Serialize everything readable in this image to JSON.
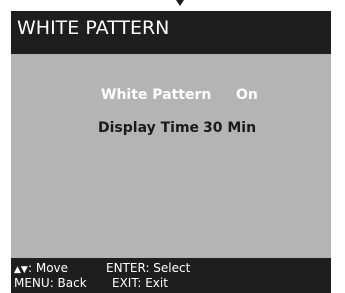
{
  "osd": {
    "title": "WHITE PATTERN",
    "menu": [
      {
        "label": "White Pattern",
        "value": "On",
        "selected": true
      },
      {
        "label": "Display Time",
        "value": "30 Min",
        "selected": false
      }
    ],
    "help": {
      "move_glyph": "▲▼",
      "move_label": ": Move",
      "select_label": "ENTER: Select",
      "back_label": "MENU:  Back",
      "exit_label": "EXIT: Exit"
    }
  },
  "colors": {
    "frame": "#1e1e1e",
    "panel": "#b4b4b4",
    "selected_text": "#ffffff",
    "normal_text": "#1a1a1a"
  },
  "icons": {
    "top_indicator": "down-triangle-icon",
    "move_arrows": "up-down-arrows-icon"
  }
}
